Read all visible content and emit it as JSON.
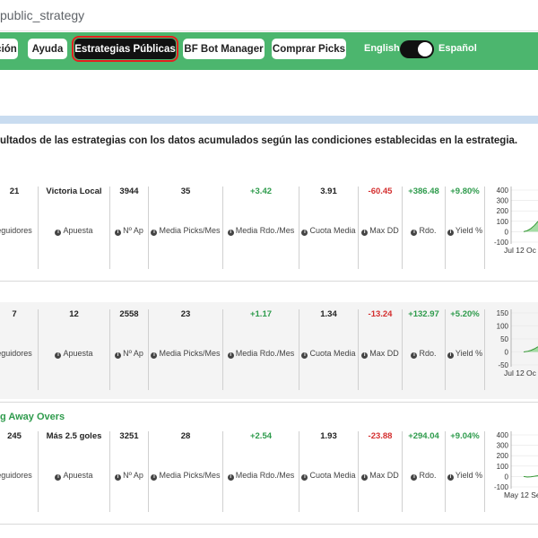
{
  "browser": {
    "url_fragment": "public_strategy"
  },
  "nav": {
    "items": [
      {
        "label": "ción"
      },
      {
        "label": "Ayuda"
      },
      {
        "label": "Estrategias Públicas",
        "active": true
      },
      {
        "label": "BF Bot Manager"
      },
      {
        "label": "Comprar Picks"
      }
    ],
    "lang_en": "English",
    "lang_es": "Español",
    "accent": "#4cb66e"
  },
  "description": "ultados de las estrategias con los datos acumulados según las condiciones establecidas en la estrategia.",
  "labels": {
    "followers": "eguidores",
    "bet": "Apuesta",
    "n_ap": "Nº Ap",
    "picks_month": "Media Picks/Mes",
    "avg_return": "Media Rdo./Mes",
    "avg_odds": "Cuota Media",
    "max_dd": "Max DD",
    "rdo": "Rdo.",
    "yield": "Yield %"
  },
  "strategies": [
    {
      "title": "",
      "followers": "21",
      "bet": "Victoria Local",
      "n_ap": "3944",
      "picks_month": "35",
      "avg_return": "+3.42",
      "avg_odds": "3.91",
      "max_dd": "-60.45",
      "rdo": "+386.48",
      "yield": "+9.80%",
      "chart": {
        "yticks": [
          "400",
          "300",
          "200",
          "100",
          "0",
          "-100"
        ],
        "xlabel": "Jul 12 Oc",
        "ymin": -100,
        "ymax": 400,
        "series": [
          0,
          10,
          30,
          60,
          100
        ]
      }
    },
    {
      "title": "",
      "followers": "7",
      "bet": "12",
      "n_ap": "2558",
      "picks_month": "23",
      "avg_return": "+1.17",
      "avg_odds": "1.34",
      "max_dd": "-13.24",
      "rdo": "+132.97",
      "yield": "+5.20%",
      "chart": {
        "yticks": [
          "150",
          "100",
          "50",
          "0",
          "-50"
        ],
        "xlabel": "Jul 12 Oc",
        "ymin": -50,
        "ymax": 150,
        "series": [
          0,
          2,
          6,
          12,
          20
        ]
      }
    },
    {
      "title": "g Away Overs",
      "followers": "245",
      "bet": "Más 2.5 goles",
      "n_ap": "3251",
      "picks_month": "28",
      "avg_return": "+2.54",
      "avg_odds": "1.93",
      "max_dd": "-23.88",
      "rdo": "+294.04",
      "yield": "+9.04%",
      "chart": {
        "yticks": [
          "400",
          "300",
          "200",
          "100",
          "0",
          "-100"
        ],
        "xlabel": "May 12 Se",
        "ymin": -100,
        "ymax": 400,
        "series": [
          0,
          -5,
          -3,
          2,
          8
        ]
      }
    }
  ]
}
